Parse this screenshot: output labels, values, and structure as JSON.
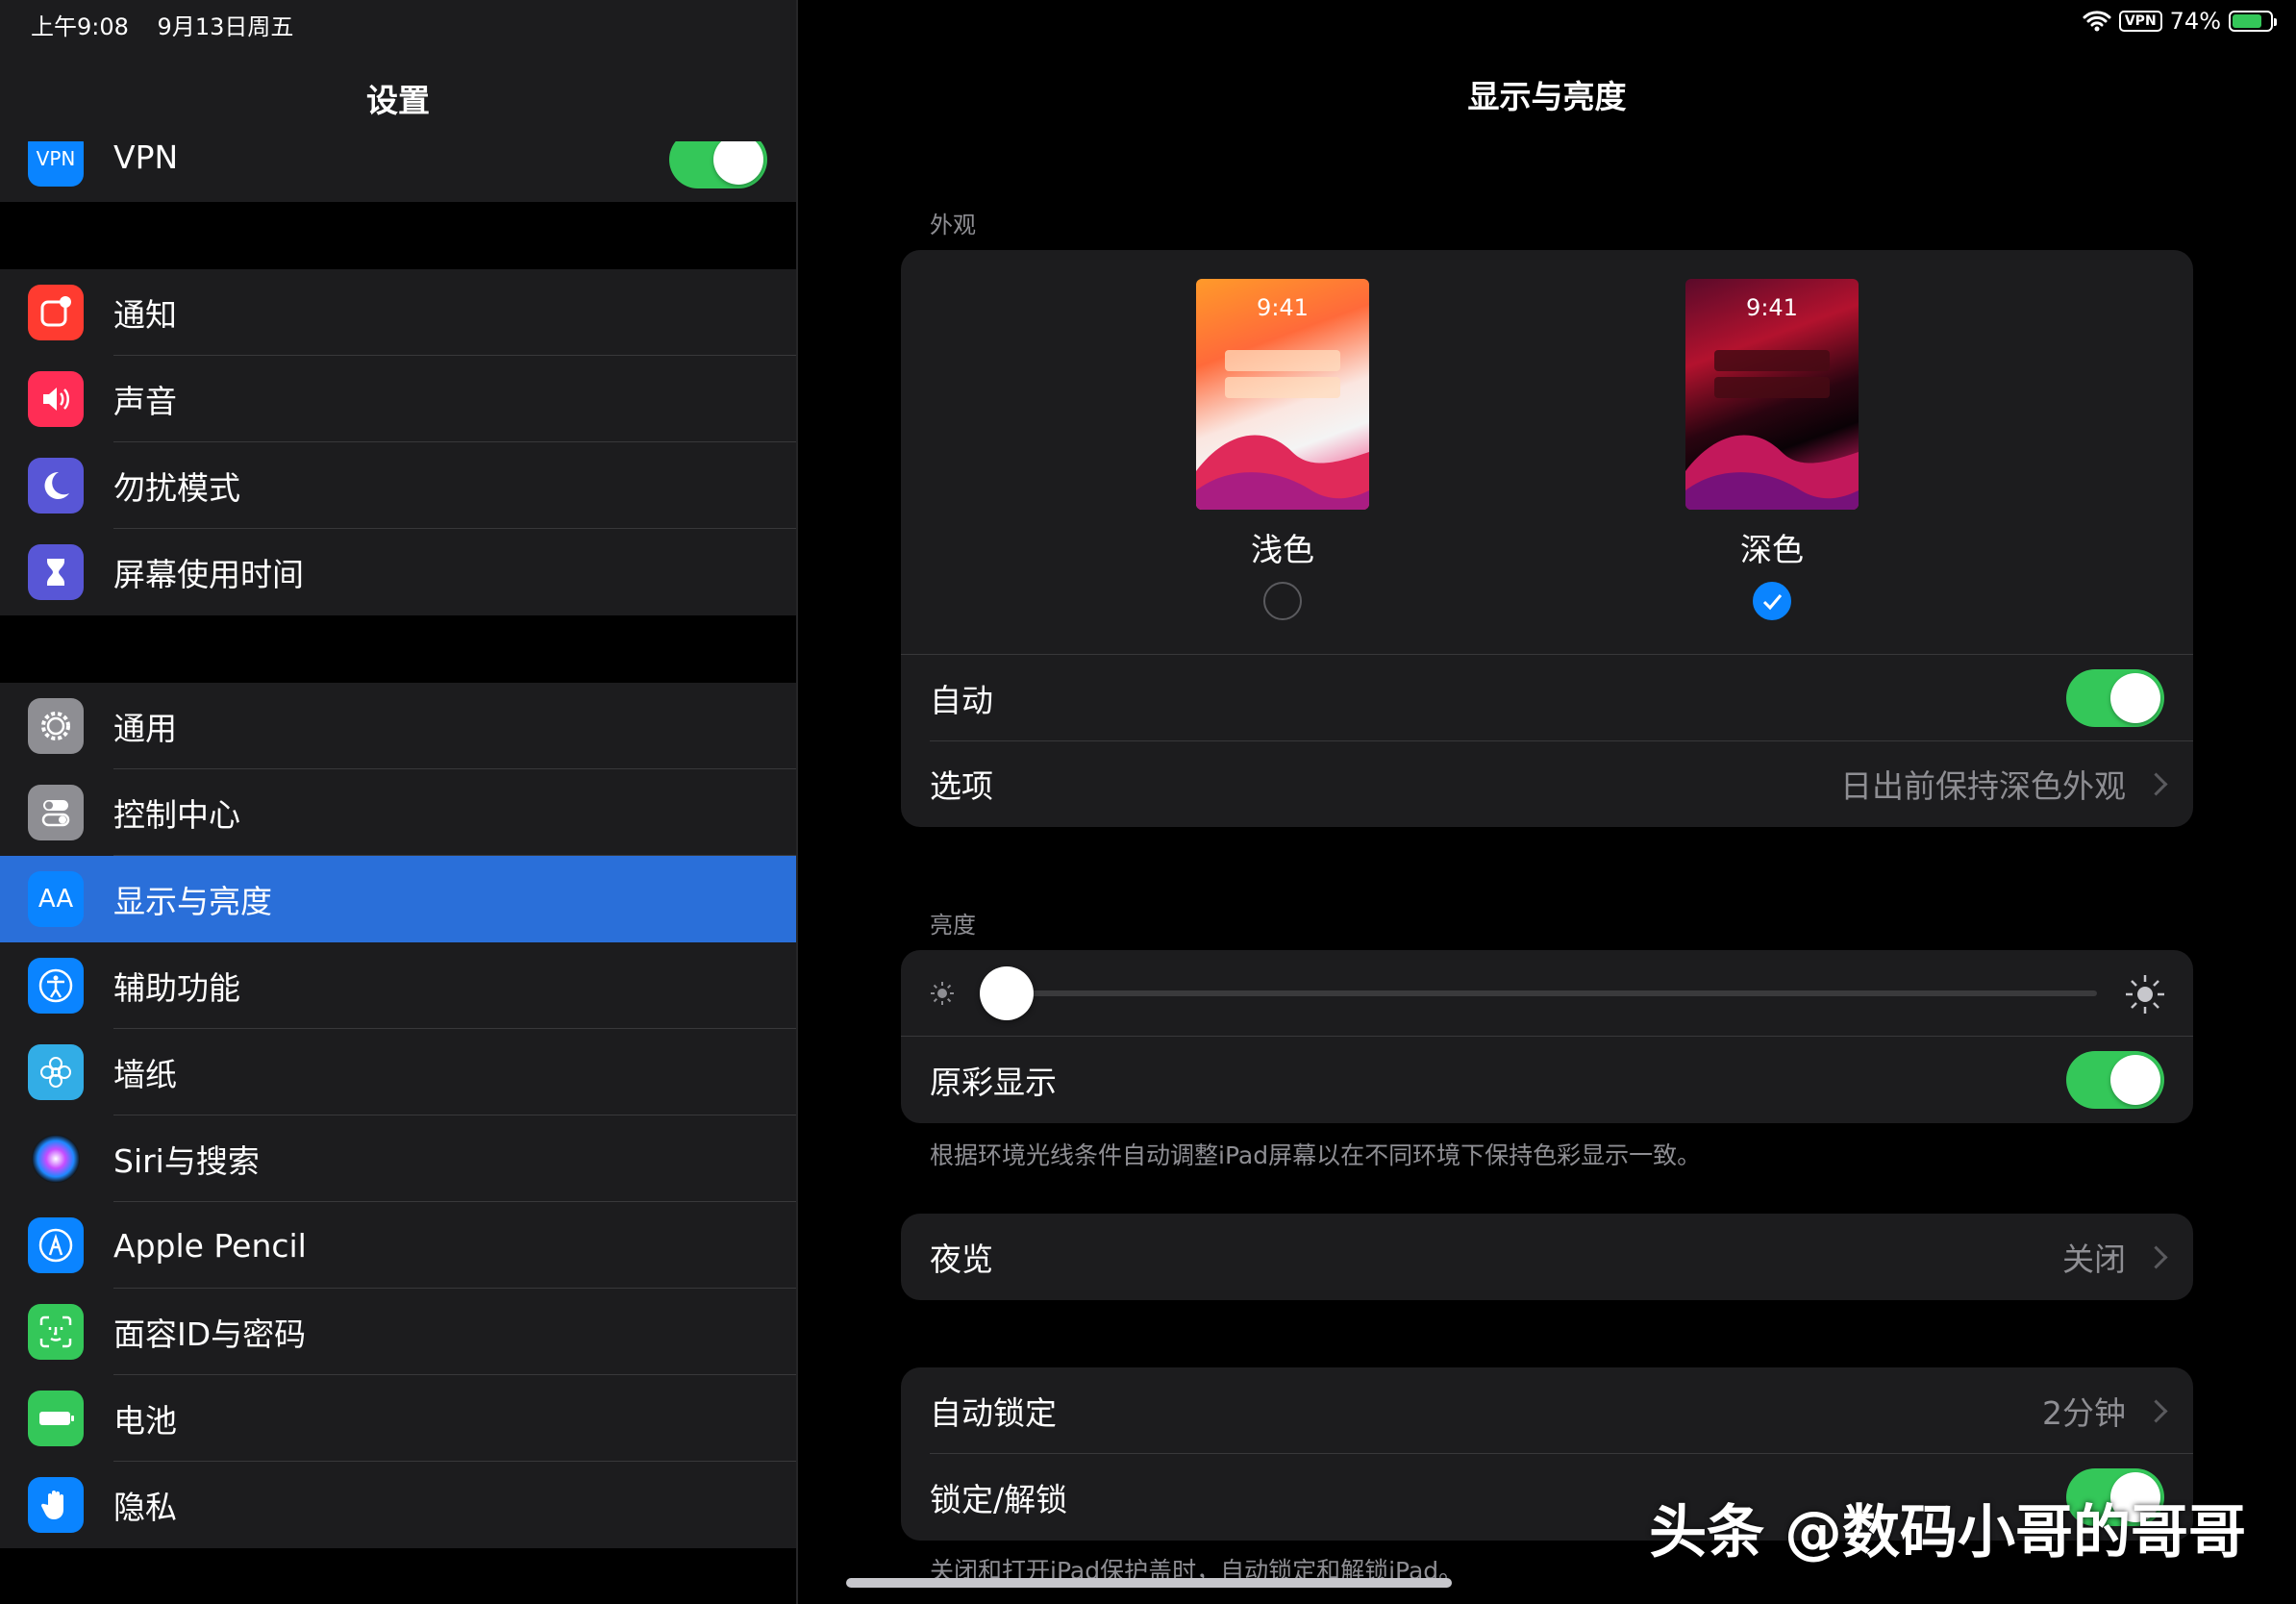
{
  "status_bar": {
    "time": "上午9:08",
    "date": "9月13日周五",
    "vpn": "VPN",
    "battery": "74%"
  },
  "sidebar": {
    "title": "设置",
    "vpn_row": {
      "label": "VPN",
      "icon_text": "VPN",
      "toggle_on": true
    },
    "group1": [
      {
        "label": "通知",
        "icon": "notification-icon",
        "color": "#ff3b30"
      },
      {
        "label": "声音",
        "icon": "speaker-icon",
        "color": "#ff2d55"
      },
      {
        "label": "勿扰模式",
        "icon": "moon-icon",
        "color": "#5856d6"
      },
      {
        "label": "屏幕使用时间",
        "icon": "hourglass-icon",
        "color": "#5856d6"
      }
    ],
    "group2": [
      {
        "label": "通用",
        "icon": "gear-icon",
        "color": "#8e8e93"
      },
      {
        "label": "控制中心",
        "icon": "switches-icon",
        "color": "#8e8e93"
      },
      {
        "label": "显示与亮度",
        "icon": "text-size-icon",
        "icon_text": "AA",
        "color": "#0a84ff",
        "selected": true
      },
      {
        "label": "辅助功能",
        "icon": "accessibility-icon",
        "color": "#0a84ff"
      },
      {
        "label": "墙纸",
        "icon": "flower-icon",
        "color": "#32ade6"
      },
      {
        "label": "Siri与搜索",
        "icon": "siri-icon",
        "color": "#1c1c1e"
      },
      {
        "label": "Apple Pencil",
        "icon": "pencil-icon",
        "color": "#0a84ff"
      },
      {
        "label": "面容ID与密码",
        "icon": "face-id-icon",
        "color": "#34c759"
      },
      {
        "label": "电池",
        "icon": "battery-icon",
        "color": "#34c759"
      },
      {
        "label": "隐私",
        "icon": "hand-icon",
        "color": "#0a84ff"
      }
    ]
  },
  "main": {
    "title": "显示与亮度",
    "appearance": {
      "section_label": "外观",
      "light": {
        "label": "浅色",
        "preview_time": "9:41",
        "selected": false
      },
      "dark": {
        "label": "深色",
        "preview_time": "9:41",
        "selected": true
      },
      "auto_label": "自动",
      "auto_on": true,
      "options_label": "选项",
      "options_value": "日出前保持深色外观"
    },
    "brightness": {
      "section_label": "亮度",
      "level": 0.0,
      "true_tone_label": "原彩显示",
      "true_tone_on": true,
      "true_tone_footnote": "根据环境光线条件自动调整iPad屏幕以在不同环境下保持色彩显示一致。"
    },
    "night_shift": {
      "label": "夜览",
      "value": "关闭"
    },
    "lock": {
      "auto_lock_label": "自动锁定",
      "auto_lock_value": "2分钟",
      "lock_unlock_label": "锁定/解锁",
      "lock_unlock_on": true,
      "footnote": "关闭和打开iPad保护盖时，自动锁定和解锁iPad。"
    }
  },
  "watermark": "头条 @数码小哥的哥哥"
}
